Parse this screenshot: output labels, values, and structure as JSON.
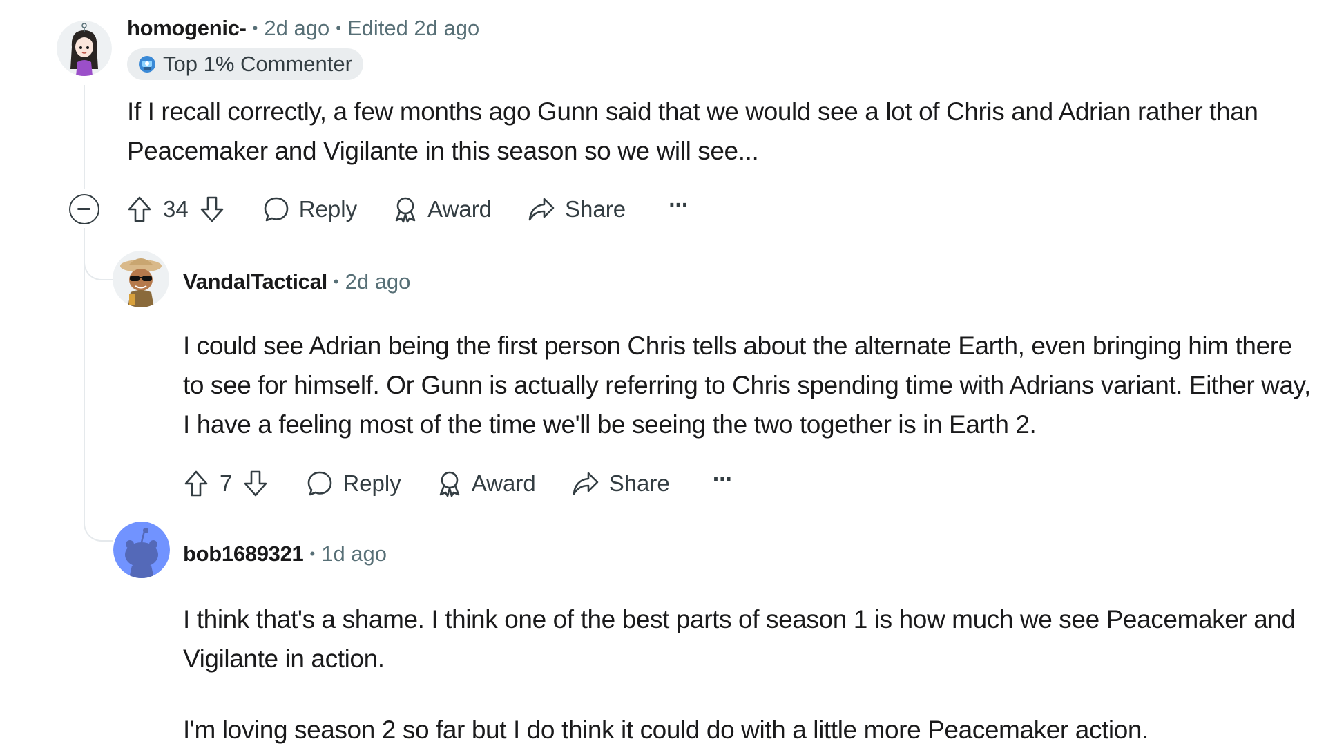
{
  "comments": [
    {
      "username": "homogenic-",
      "time": "2d ago",
      "edited": "Edited 2d ago",
      "flair": "Top 1% Commenter",
      "body": [
        "If I recall correctly, a few months ago Gunn said that we would see a lot of Chris and Adrian rather than Peacemaker and Vigilante in this season so we will see..."
      ],
      "score": "34",
      "actions": {
        "reply": "Reply",
        "award": "Award",
        "share": "Share",
        "more": "···"
      }
    },
    {
      "username": "VandalTactical",
      "time": "2d ago",
      "body": [
        "I could see Adrian being the first person Chris tells about the alternate Earth, even bringing him there to see for himself. Or Gunn is actually referring to Chris spending time with Adrians variant. Either way, I have a feeling most of the time we'll be seeing the two together is in Earth 2."
      ],
      "score": "7",
      "actions": {
        "reply": "Reply",
        "award": "Award",
        "share": "Share",
        "more": "···"
      }
    },
    {
      "username": "bob1689321",
      "time": "1d ago",
      "body": [
        "I think that's a shame. I think one of the best parts of season 1 is how much we see Peacemaker and Vigilante in action.",
        "I'm loving season 2 so far but I do think it could do with a little more Peacemaker action."
      ]
    }
  ],
  "separator": "•",
  "icons": {
    "collapse": "collapse-minus-icon",
    "upvote": "upvote-arrow-icon",
    "downvote": "downvote-arrow-icon",
    "reply": "comment-bubble-icon",
    "award": "award-ribbon-icon",
    "share": "share-arrow-icon",
    "more": "more-dots-icon",
    "flair": "top-commenter-icon"
  },
  "colors": {
    "text": "#1a1a1b",
    "meta": "#576f76",
    "rail": "#e5e9ec",
    "flair_bg": "#eaedef",
    "default_avatar_bg": "#7193ff"
  }
}
